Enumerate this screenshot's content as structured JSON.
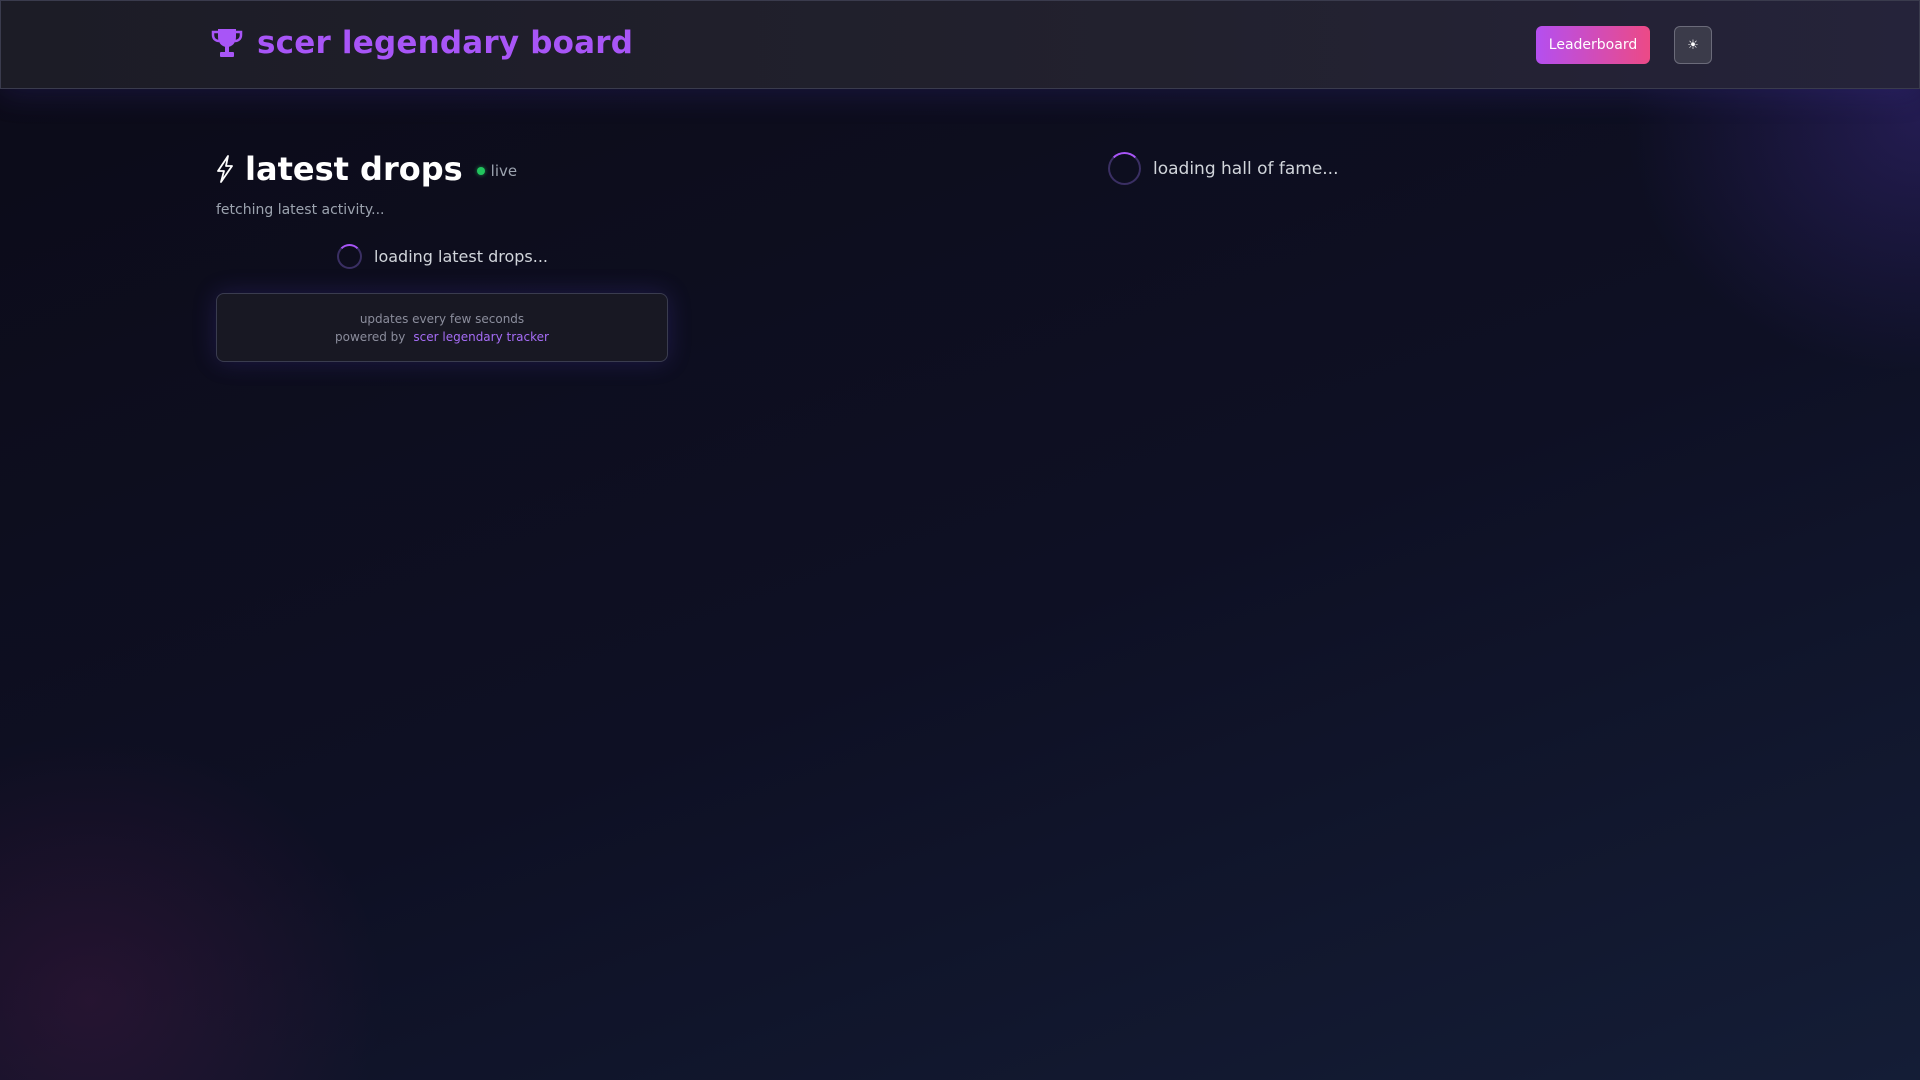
{
  "header": {
    "title": "scer legendary board",
    "icon": "trophy-icon",
    "leaderboard_label": "Leaderboard",
    "theme_toggle_label": "☀",
    "accent_color": "#a855f7"
  },
  "drops": {
    "icon": "lightning-bolt-icon",
    "title": "latest drops",
    "live_label": "live",
    "status_text": "fetching latest activity...",
    "loading_text": "loading latest drops...",
    "info": {
      "update_note": "updates every few seconds",
      "powered_label": "powered by",
      "link_text": "scer legendary tracker"
    }
  },
  "hall_of_fame": {
    "loading_text": "loading hall of fame..."
  }
}
